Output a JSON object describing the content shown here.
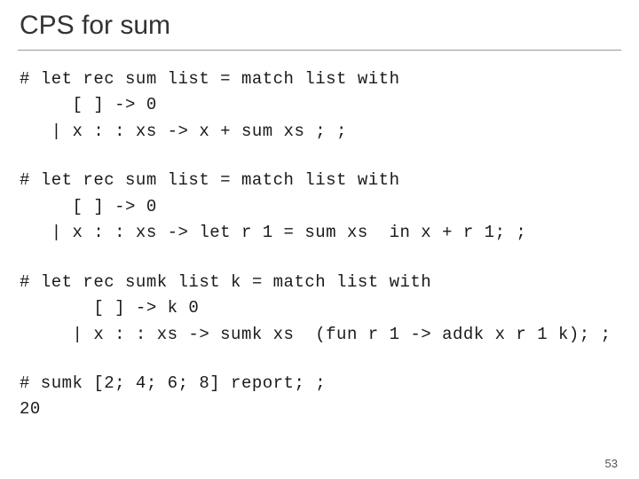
{
  "title": "CPS for sum",
  "codeblocks": [
    "# let rec sum list = match list with\n     [ ] -> 0\n   | x : : xs -> x + sum xs ; ;",
    "# let rec sum list = match list with\n     [ ] -> 0\n   | x : : xs -> let r 1 = sum xs  in x + r 1; ;",
    "# let rec sumk list k = match list with\n       [ ] -> k 0\n     | x : : xs -> sumk xs  (fun r 1 -> addk x r 1 k); ;",
    "# sumk [2; 4; 6; 8] report; ;\n20"
  ],
  "page_number": "53"
}
